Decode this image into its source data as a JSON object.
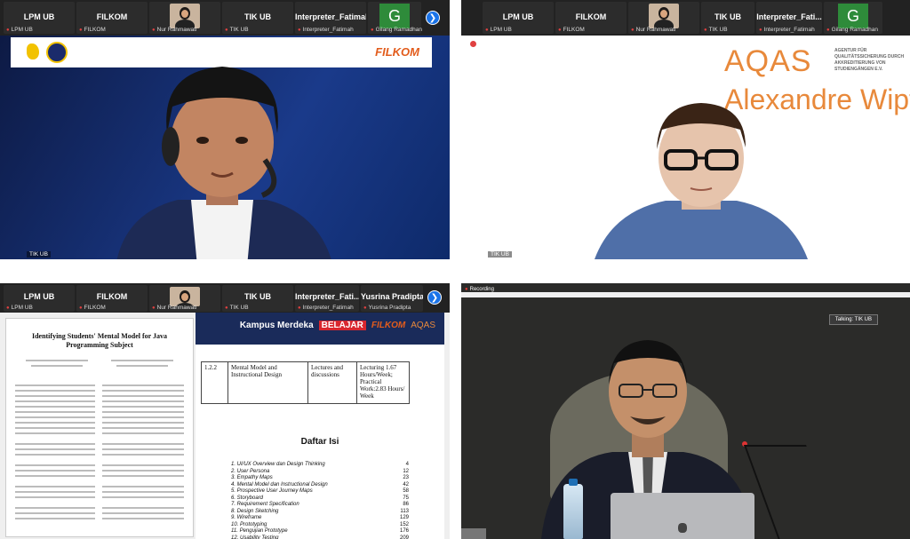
{
  "quadrants": {
    "q1": {
      "strip": [
        "LPM UB",
        "FILKOM",
        "Nur Rahmawati",
        "TIK UB",
        "Interpreter_Fatimah",
        "Gilang Ramadhan"
      ],
      "strip_small": [
        "LPM UB",
        "FILKOM",
        "Nur Rahmawati",
        "TIK UB",
        "Interpreter_Fatimah",
        "Gilang Ramadhan"
      ],
      "avatar_letter": "G",
      "banner_brand": "FILKOM",
      "label": "TIK UB"
    },
    "q2": {
      "strip": [
        "LPM UB",
        "FILKOM",
        "Nur Rahmawati",
        "TIK UB",
        "Interpreter_Fati...",
        "Gilang Ramadhan"
      ],
      "strip_small": [
        "LPM UB",
        "FILKOM",
        "Nur Rahmawati",
        "TIK UB",
        "Interpreter_Fatimah",
        "Gilang Ramadhan"
      ],
      "avatar_letter": "G",
      "aqas_logo": "AQAS",
      "aqas_sub": "AGENTUR FÜR QUALITÄTSSICHERUNG DURCH AKKREDITIERUNG VON STUDIENGÄNGEN E.V.",
      "speaker": "Alexandre Wipf",
      "label": "TIK UB"
    },
    "q3": {
      "strip": [
        "LPM UB",
        "FILKOM",
        "Nur Rahmawati",
        "TIK UB",
        "Interpreter_Fati...",
        "Yusrina Pradipta"
      ],
      "strip_small": [
        "LPM UB",
        "FILKOM",
        "Nur Rahmawati",
        "TIK UB",
        "Interpreter_Fatimah",
        "Yusrina Pradipta"
      ],
      "paper_title": "Identifying Students' Mental Model for Java Programming Subject",
      "slide_logos": [
        "Kampus Merdeka",
        "BELAJAR",
        "FILKOM",
        "AQAS"
      ],
      "table": {
        "num": "1.2.2",
        "topic": "Mental Model and Instructional Design",
        "method": "Lectures and discussions",
        "time": "Lecturing 1.67 Hours/Week; Practical Work:2.83 Hours/ Week"
      },
      "toc_title": "Daftar Isi",
      "toc": [
        {
          "label": "1.  UI/UX Overview dan Design Thinking",
          "page": "4"
        },
        {
          "label": "2.  User Persona",
          "page": "12"
        },
        {
          "label": "3.  Empathy Maps",
          "page": "23"
        },
        {
          "label": "4.  Mental Model dan Instructional Design",
          "page": "42"
        },
        {
          "label": "5.  Prospective User Journey Maps",
          "page": "58"
        },
        {
          "label": "6.  Storyboard",
          "page": "75"
        },
        {
          "label": "7.  Requirement Specification",
          "page": "86"
        },
        {
          "label": "8.  Design Sketching",
          "page": "113"
        },
        {
          "label": "9.  Wireframe",
          "page": "129"
        },
        {
          "label": "10. Prototyping",
          "page": "152"
        },
        {
          "label": "11. Pengujian Prototype",
          "page": "176"
        },
        {
          "label": "12. Usability Testing",
          "page": "209"
        }
      ]
    },
    "q4": {
      "recording": "Recording",
      "talking": "Talking: TIK UB"
    }
  },
  "colors": {
    "accent_blue": "#1a73e8",
    "aqas_orange": "#e8893b",
    "filkom_orange": "#e25c1c"
  }
}
